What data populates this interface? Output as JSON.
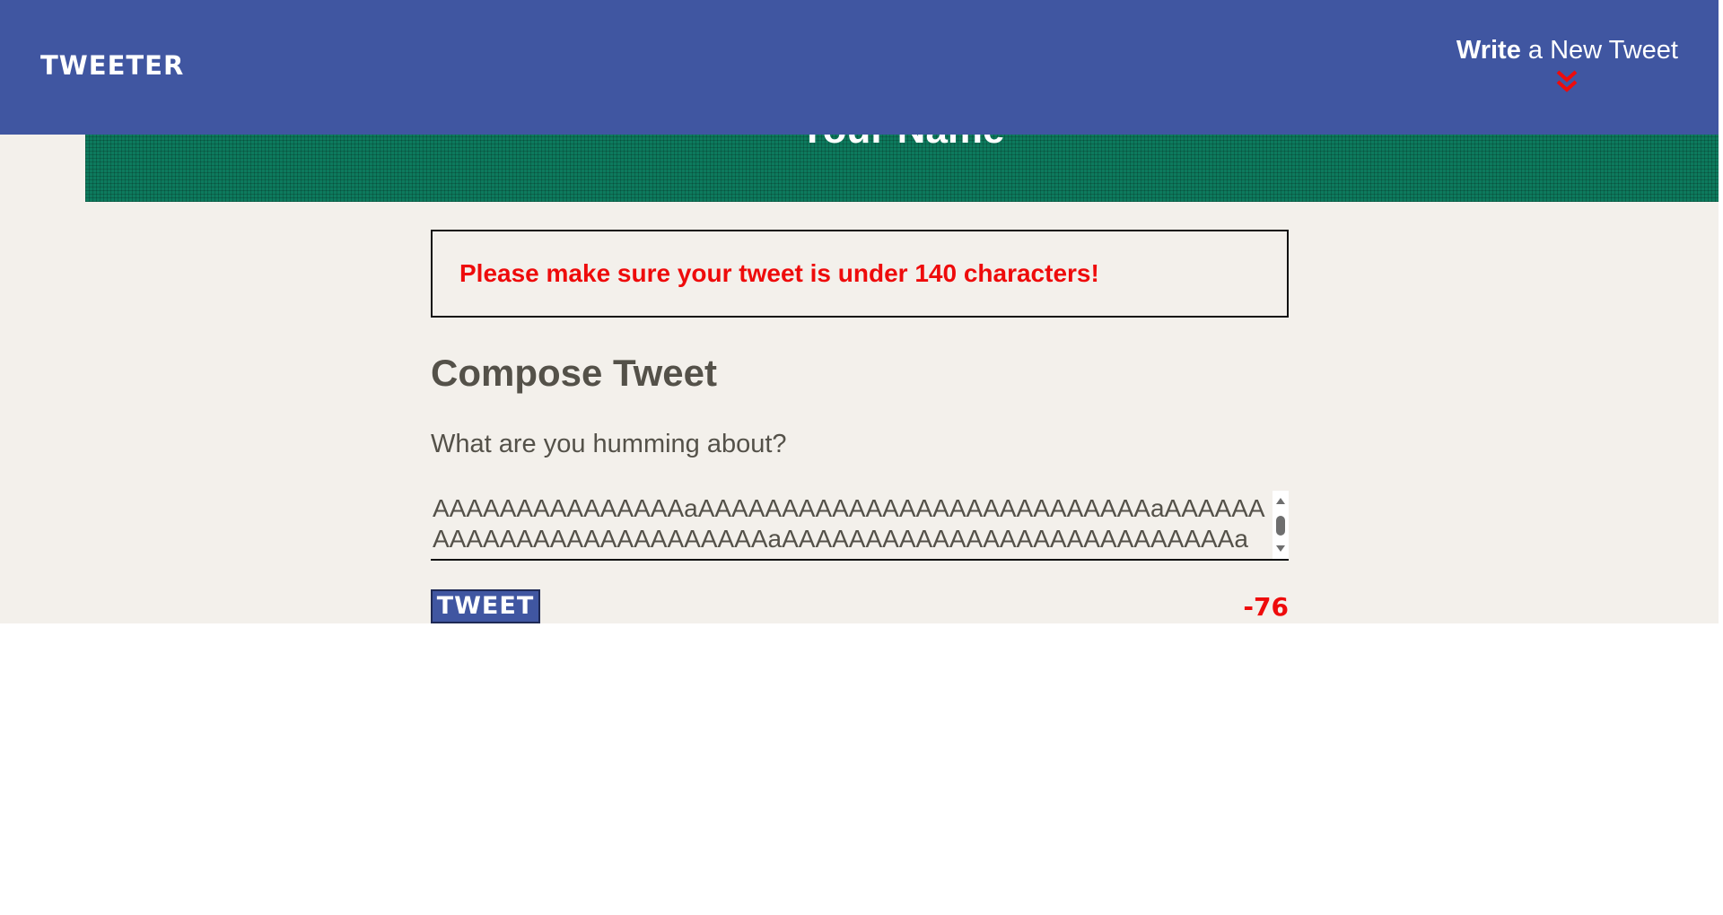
{
  "nav": {
    "brand": "TWEETER",
    "write_bold": "Write",
    "write_rest": " a New Tweet",
    "chevron_icon": "double-chevron-down",
    "chevron_color": "#ee0b0b"
  },
  "banner": {
    "name": "Your Name"
  },
  "error": {
    "message": "Please make sure your tweet is under 140 characters!"
  },
  "compose": {
    "title": "Compose Tweet",
    "placeholder": "What are you humming about?",
    "text": "AAAAAAAAAAAAAAAaAAAAAAAAAAAAAAAAAAAAAAAAAAAaAAAAAAAAAAAAAAAAAAAAAAAAAAaAAAAAAAAAAAAAAAAAAAAAAAAAAAa",
    "button_label": "TWEET",
    "counter": "-76"
  },
  "colors": {
    "nav_bg": "#4056a1",
    "banner_bg": "#0d7a5d",
    "page_bg": "#f3f0eb",
    "error": "#ee0b0b",
    "text": "#545149"
  }
}
